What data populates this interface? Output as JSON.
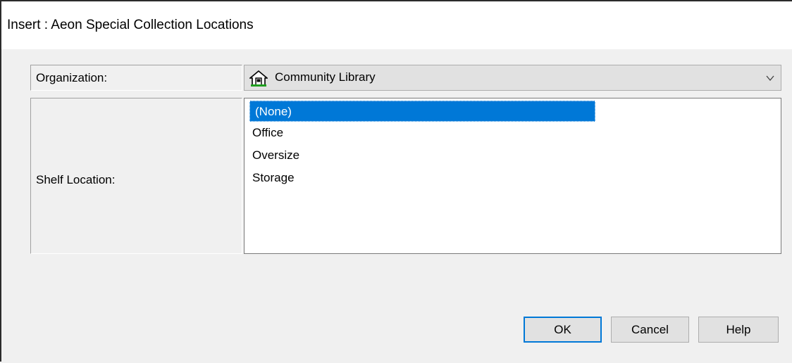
{
  "window": {
    "title": "Insert : Aeon Special Collection Locations"
  },
  "form": {
    "organization_label": "Organization:",
    "organization_value": "Community Library",
    "organization_icon": "house-icon",
    "shelf_location_label": "Shelf Location:",
    "shelf_location_options": [
      "(None)",
      "Office",
      "Oversize",
      "Storage"
    ],
    "shelf_location_selected": "(None)"
  },
  "buttons": {
    "ok": "OK",
    "cancel": "Cancel",
    "help": "Help"
  },
  "colors": {
    "selection": "#0078d7",
    "default_button_border": "#0078d7",
    "dialog_bg": "#f0f0f0"
  }
}
